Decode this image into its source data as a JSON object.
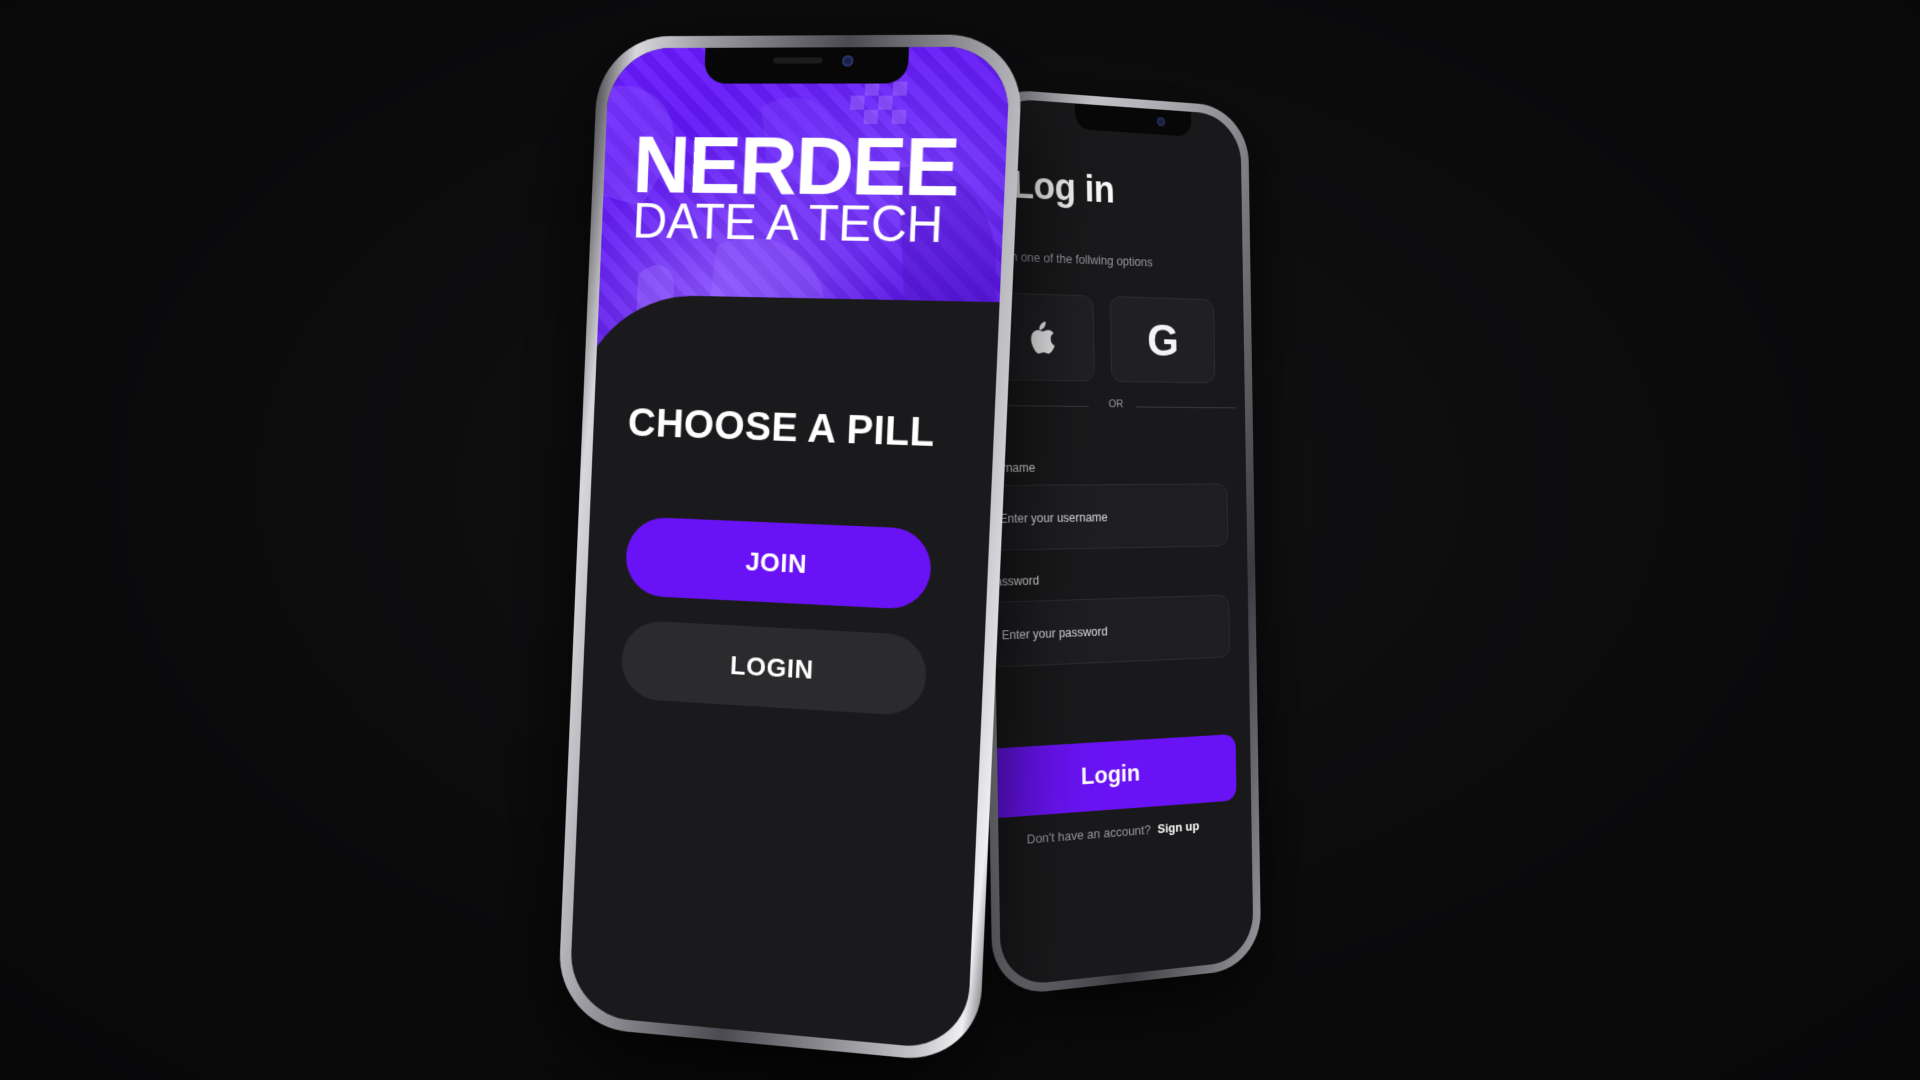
{
  "colors": {
    "accent": "#6a12f6",
    "background": "#0b0b0c",
    "screen": "#1a1a1c",
    "secondary_button": "#2b2b2e"
  },
  "welcome_screen": {
    "brand_title": "NERDEE",
    "brand_tagline": "DATE A TECH",
    "heading": "CHOOSE A PILL",
    "join_label": "JOIN",
    "login_label": "LOGIN"
  },
  "login_screen": {
    "title": "Log in",
    "subtitle": "th one of the follwing options",
    "social": {
      "apple_icon": "apple-icon",
      "google_icon": "google-icon",
      "google_glyph": "G"
    },
    "divider_text": "OR",
    "username": {
      "label": "Username",
      "placeholder": "Enter your username"
    },
    "password": {
      "label": "Password",
      "placeholder": "Enter your password"
    },
    "submit_label": "Login",
    "signup_prompt": "Don't have an account?",
    "signup_link": "Sign up"
  }
}
